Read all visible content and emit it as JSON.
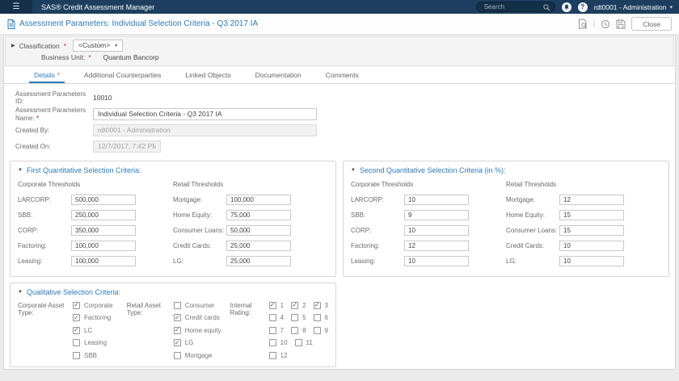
{
  "icons": {
    "hamburger": "☰",
    "caret_down": "▾",
    "collapse_right": "▶",
    "collapse_down": "▼",
    "check": "✓",
    "help": "?",
    "separator": "|"
  },
  "required_marker": "*",
  "colors": {
    "appbar": "#1d3e5e",
    "accent": "#2e7cbc",
    "required": "#b5342a"
  },
  "app_bar": {
    "title": "SAS® Credit Assessment Manager",
    "search_placeholder": "Search",
    "user": "rdt0001 - Administration"
  },
  "toolbar": {
    "page_title": "Assessment Parameters: Individual Selection Criteria - Q3 2017 IA",
    "close_label": "Close"
  },
  "classification": {
    "label": "Classification",
    "dropdown_value": "<Custom>",
    "business_unit_label": "Business Unit:",
    "business_unit_value": "Quantum Bancorp"
  },
  "tabs": [
    {
      "label": "Details",
      "required": true,
      "active": true
    },
    {
      "label": "Additional Counterparties",
      "required": false,
      "active": false
    },
    {
      "label": "Linked Objects",
      "required": false,
      "active": false
    },
    {
      "label": "Documentation",
      "required": false,
      "active": false
    },
    {
      "label": "Comments",
      "required": false,
      "active": false
    }
  ],
  "form": {
    "id_label": "Assessment Parameters ID:",
    "id_value": "10010",
    "name_label": "Assessment Parameters Name:",
    "name_value": "Individual Selection Criteria - Q3 2017 IA",
    "created_by_label": "Created By:",
    "created_by_value": "rdt0001 - Administration",
    "created_on_label": "Created On:",
    "created_on_value": "12/7/2017, 7:42 PM"
  },
  "first_quant": {
    "title": "First Quantitative Selection Criteria:",
    "corporate_header": "Corporate Thresholds",
    "retail_header": "Retail Thresholds",
    "corporate_fields": [
      {
        "label": "LARCORP:",
        "value": "500,000"
      },
      {
        "label": "SBB:",
        "value": "250,000"
      },
      {
        "label": "CORP:",
        "value": "350,000"
      },
      {
        "label": "Factoring:",
        "value": "100,000"
      },
      {
        "label": "Leasing:",
        "value": "100,000"
      }
    ],
    "retail_fields": [
      {
        "label": "Mortgage:",
        "value": "100,000"
      },
      {
        "label": "Home Equity:",
        "value": "75,000"
      },
      {
        "label": "Consumer Loans:",
        "value": "50,000"
      },
      {
        "label": "Credit Cards:",
        "value": "25,000"
      },
      {
        "label": "LG:",
        "value": "25,000"
      }
    ]
  },
  "second_quant": {
    "title": "Second Quantitative Selection Criteria (in %):",
    "corporate_header": "Corporate Thresholds",
    "retail_header": "Retail Thresholds",
    "corporate_fields": [
      {
        "label": "LARCORP:",
        "value": "10"
      },
      {
        "label": "SBB:",
        "value": "9"
      },
      {
        "label": "CORP:",
        "value": "10"
      },
      {
        "label": "Factoring:",
        "value": "12"
      },
      {
        "label": "Leasing:",
        "value": "10"
      }
    ],
    "retail_fields": [
      {
        "label": "Mortgage:",
        "value": "12"
      },
      {
        "label": "Home Equity:",
        "value": "15"
      },
      {
        "label": "Consumer Loans:",
        "value": "15"
      },
      {
        "label": "Credit Cards:",
        "value": "10"
      },
      {
        "label": "LG:",
        "value": "10"
      }
    ]
  },
  "qualitative": {
    "title": "Qualitative Selection Criteria:",
    "corporate_group_label": "Corporate Asset Type:",
    "corporate_options": [
      {
        "label": "Corporate",
        "checked": true
      },
      {
        "label": "Factoring",
        "checked": true
      },
      {
        "label": "LC",
        "checked": true
      },
      {
        "label": "Leasing",
        "checked": false
      },
      {
        "label": "SBB",
        "checked": false
      }
    ],
    "retail_group_label": "Retail Asset Type:",
    "retail_options": [
      {
        "label": "Consumer",
        "checked": false
      },
      {
        "label": "Credit cards",
        "checked": true
      },
      {
        "label": "Home equity",
        "checked": true
      },
      {
        "label": "LG",
        "checked": true
      },
      {
        "label": "Mortgage",
        "checked": false
      }
    ],
    "rating_group_label": "Internal Rating:",
    "rating_rows": [
      [
        {
          "label": "1",
          "checked": true
        },
        {
          "label": "2",
          "checked": true
        },
        {
          "label": "3",
          "checked": true
        }
      ],
      [
        {
          "label": "4",
          "checked": false
        },
        {
          "label": "5",
          "checked": false
        },
        {
          "label": "6",
          "checked": false
        }
      ],
      [
        {
          "label": "7",
          "checked": false
        },
        {
          "label": "8",
          "checked": false
        },
        {
          "label": "9",
          "checked": false
        }
      ],
      [
        {
          "label": "10",
          "checked": false
        },
        {
          "label": "11",
          "checked": false
        }
      ],
      [
        {
          "label": "12",
          "checked": false
        }
      ]
    ]
  }
}
